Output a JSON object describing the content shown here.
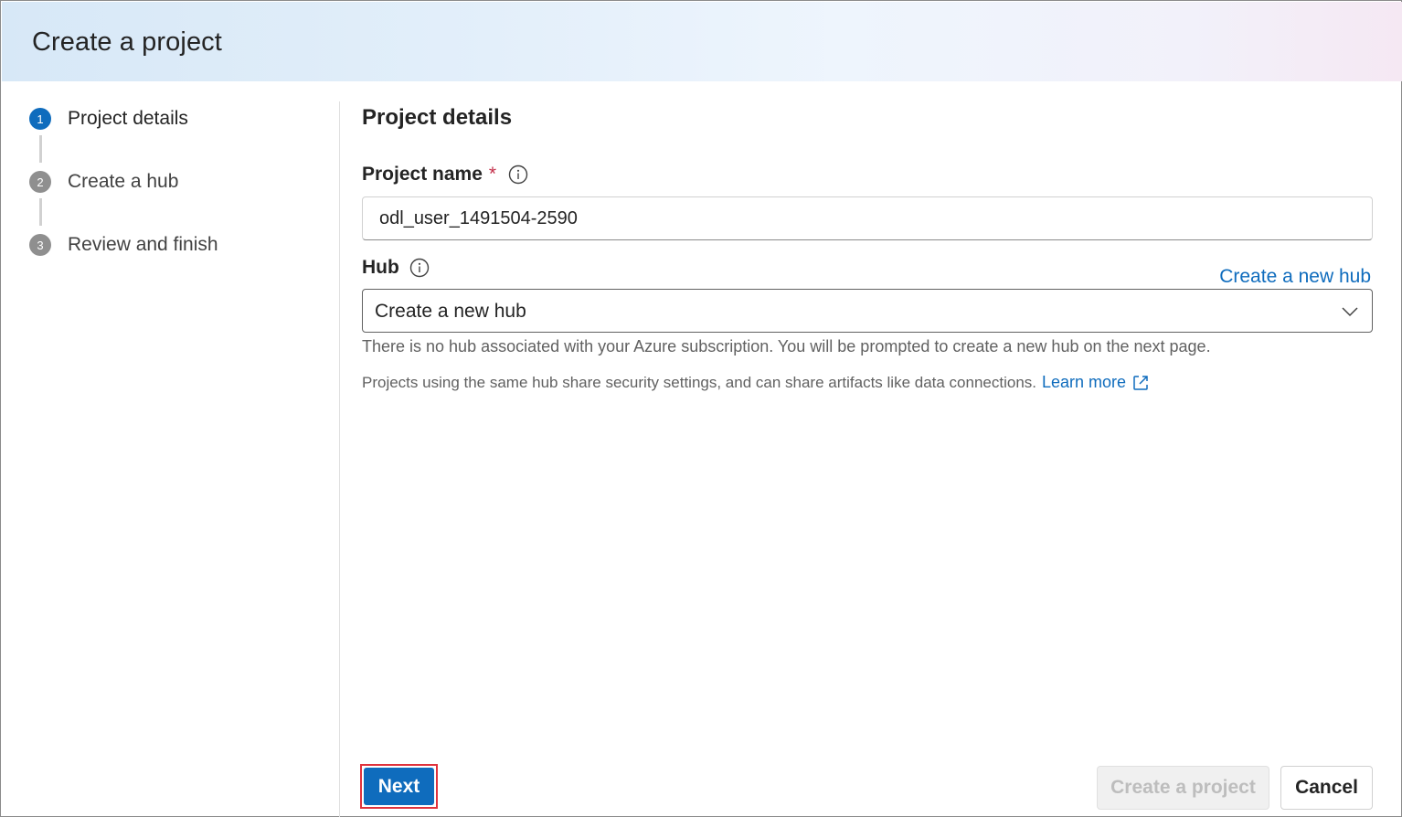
{
  "dialog": {
    "title": "Create a project"
  },
  "stepper": {
    "steps": [
      {
        "number": "1",
        "label": "Project details",
        "state": "active"
      },
      {
        "number": "2",
        "label": "Create a hub",
        "state": "inactive"
      },
      {
        "number": "3",
        "label": "Review and finish",
        "state": "inactive"
      }
    ]
  },
  "main": {
    "section_title": "Project details",
    "project_name": {
      "label": "Project name",
      "required_marker": "*",
      "value": "odl_user_1491504-2590"
    },
    "hub": {
      "label": "Hub",
      "create_link": "Create a new hub",
      "selected": "Create a new hub",
      "helper": "There is no hub associated with your Azure subscription. You will be prompted to create a new hub on the next page."
    },
    "note": {
      "text": "Projects using the same hub share security settings, and can share artifacts like data connections.",
      "link": "Learn more"
    }
  },
  "footer": {
    "next_label": "Next",
    "create_label": "Create a project",
    "cancel_label": "Cancel"
  },
  "colors": {
    "accent": "#0f6cbd",
    "required": "#c4314b",
    "highlight_border": "#e0323c"
  }
}
